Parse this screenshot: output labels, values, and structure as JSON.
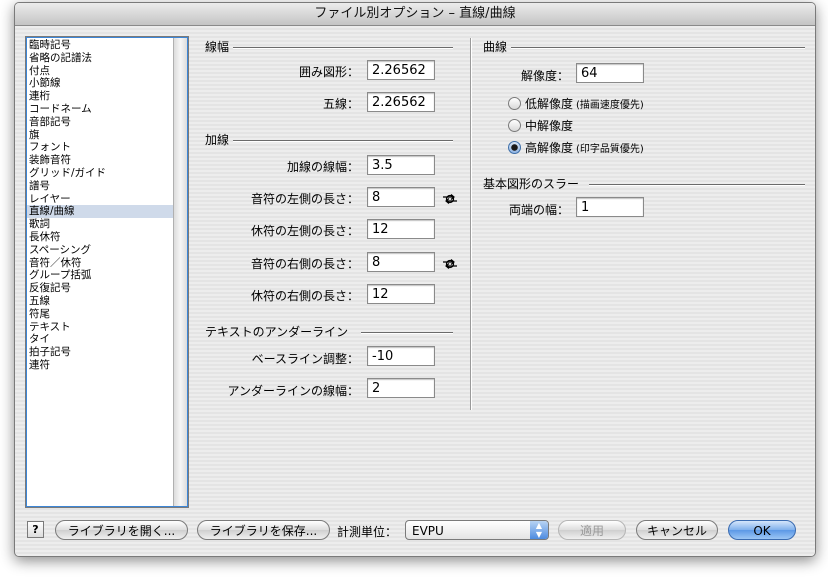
{
  "window": {
    "title": "ファイル別オプション – 直線/曲線"
  },
  "categories": {
    "items": [
      "臨時記号",
      "省略の記譜法",
      "付点",
      "小節線",
      "連桁",
      "コードネーム",
      "音部記号",
      "旗",
      "フォント",
      "装飾音符",
      "グリッド/ガイド",
      "譜号",
      "レイヤー",
      "直線/曲線",
      "歌詞",
      "長休符",
      "スペーシング",
      "音符／休符",
      "グループ括弧",
      "反復記号",
      "五線",
      "符尾",
      "テキスト",
      "タイ",
      "拍子記号",
      "連符"
    ],
    "selected": "直線/曲線"
  },
  "linewidth": {
    "title": "線幅",
    "rows": [
      {
        "label": "囲み図形：",
        "value": "2.26562"
      },
      {
        "label": "五線：",
        "value": "2.26562"
      }
    ]
  },
  "ledger": {
    "title": "加線",
    "rows": [
      {
        "label": "加線の線幅：",
        "value": "3.5"
      },
      {
        "label": "音符の左側の長さ：",
        "value": "8"
      },
      {
        "label": "休符の左側の長さ：",
        "value": "12"
      },
      {
        "label": "音符の右側の長さ：",
        "value": "8"
      },
      {
        "label": "休符の右側の長さ：",
        "value": "12"
      }
    ]
  },
  "underline": {
    "title": "テキストのアンダーライン",
    "rows": [
      {
        "label": "ベースライン調整：",
        "value": "-10"
      },
      {
        "label": "アンダーラインの線幅：",
        "value": "2"
      }
    ]
  },
  "curves": {
    "title": "曲線",
    "resolution_label": "解像度：",
    "resolution_value": "64",
    "options": [
      {
        "label": "低解像度",
        "hint": "(描画速度優先)",
        "checked": false
      },
      {
        "label": "中解像度",
        "hint": "",
        "checked": false
      },
      {
        "label": "高解像度",
        "hint": "(印字品質優先)",
        "checked": true
      }
    ]
  },
  "slur": {
    "title": "基本図形のスラー",
    "label": "両端の幅：",
    "value": "1"
  },
  "footer": {
    "help": "?",
    "open_library": "ライブラリを開く...",
    "save_library": "ライブラリを保存...",
    "units_label": "計測単位：",
    "units_value": "EVPU",
    "apply": "適用",
    "cancel": "キャンセル",
    "ok": "OK"
  },
  "colors": {
    "accent": "#5c98e6",
    "selection": "#cfdaea"
  }
}
